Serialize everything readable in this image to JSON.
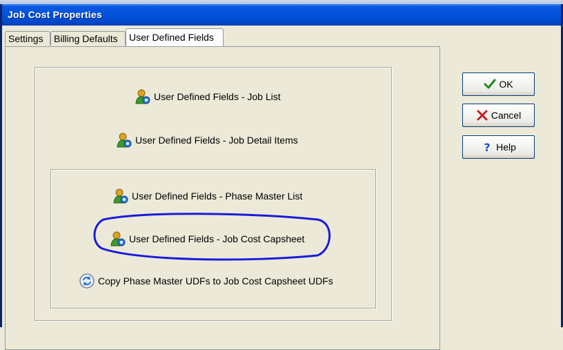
{
  "window": {
    "title": "Job Cost Properties"
  },
  "tabs": [
    {
      "label": "Settings",
      "active": false
    },
    {
      "label": "Billing Defaults",
      "active": false
    },
    {
      "label": "User Defined Fields",
      "active": true
    }
  ],
  "links": {
    "job_list": {
      "label": "User Defined Fields - Job List",
      "icon": "users-gear-icon"
    },
    "job_detail_items": {
      "label": "User Defined Fields - Job Detail Items",
      "icon": "users-gear-icon"
    },
    "phase_master_list": {
      "label": "User Defined Fields - Phase Master List",
      "icon": "users-gear-icon"
    },
    "job_cost_capsheet": {
      "label": "User Defined Fields - Job Cost Capsheet",
      "icon": "users-gear-icon",
      "highlighted": true
    },
    "copy_phase_udfs": {
      "label": "Copy Phase Master UDFs to Job Cost Capsheet UDFs",
      "icon": "copy-refresh-icon"
    }
  },
  "buttons": {
    "ok": {
      "label": "OK",
      "icon": "checkmark-icon"
    },
    "cancel": {
      "label": "Cancel",
      "icon": "x-icon"
    },
    "help": {
      "label": "Help",
      "icon": "question-icon"
    }
  },
  "colors": {
    "titlebar": "#0352d8",
    "annotation": "#1a1adc",
    "ok_check": "#1b8a1b",
    "cancel_x": "#c41e1e",
    "help_q": "#1d4fd6"
  }
}
